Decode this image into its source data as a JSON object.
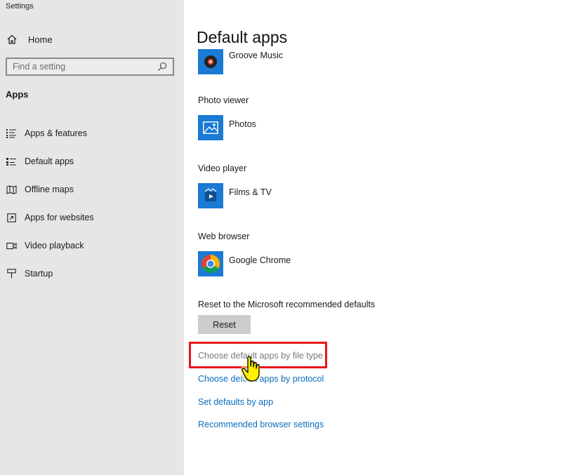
{
  "window": {
    "title": "Settings"
  },
  "sidebar": {
    "home_label": "Home",
    "search_placeholder": "Find a setting",
    "section_title": "Apps",
    "items": [
      {
        "label": "Apps & features",
        "icon": "apps-features-icon"
      },
      {
        "label": "Default apps",
        "icon": "default-apps-icon"
      },
      {
        "label": "Offline maps",
        "icon": "offline-maps-icon"
      },
      {
        "label": "Apps for websites",
        "icon": "apps-websites-icon"
      },
      {
        "label": "Video playback",
        "icon": "video-playback-icon"
      },
      {
        "label": "Startup",
        "icon": "startup-icon"
      }
    ]
  },
  "main": {
    "title": "Default apps",
    "music": {
      "app": "Groove Music"
    },
    "photo": {
      "label": "Photo viewer",
      "app": "Photos"
    },
    "video": {
      "label": "Video player",
      "app": "Films & TV"
    },
    "browser": {
      "label": "Web browser",
      "app": "Google Chrome"
    },
    "reset": {
      "label": "Reset to the Microsoft recommended defaults",
      "button": "Reset"
    },
    "links": [
      "Choose default apps by file type",
      "Choose default apps by protocol",
      "Set defaults by app",
      "Recommended browser settings"
    ]
  },
  "colors": {
    "accent": "#0a6cbd",
    "tile": "#1a7ad4",
    "highlight": "#e8141b",
    "sidebar_bg": "#e6e6e6"
  }
}
